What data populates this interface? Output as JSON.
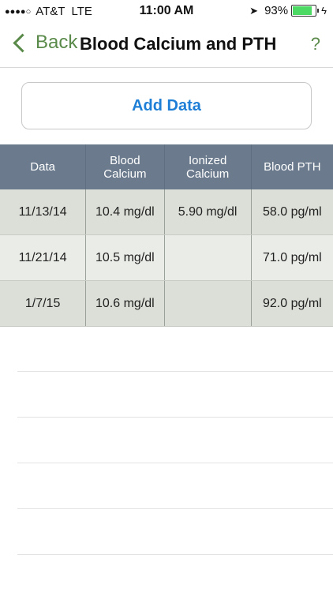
{
  "status_bar": {
    "signal": "●●●●○",
    "carrier": "AT&T",
    "network": "LTE",
    "time": "11:00 AM",
    "battery_pct": "93%",
    "battery_level": 0.93
  },
  "nav": {
    "back_label": "Back",
    "title": "Blood Calcium and PTH",
    "help_label": "?"
  },
  "add_button": {
    "label": "Add Data"
  },
  "table": {
    "headers": {
      "date": "Data",
      "blood_calcium": "Blood\nCalcium",
      "ionized_calcium": "Ionized\nCalcium",
      "blood_pth": "Blood PTH"
    },
    "rows": [
      {
        "date": "11/13/14",
        "blood_calcium": "10.4 mg/dl",
        "ionized_calcium": "5.90 mg/dl",
        "blood_pth": "58.0 pg/ml"
      },
      {
        "date": "11/21/14",
        "blood_calcium": "10.5 mg/dl",
        "ionized_calcium": "",
        "blood_pth": "71.0 pg/ml"
      },
      {
        "date": "1/7/15",
        "blood_calcium": "10.6 mg/dl",
        "ionized_calcium": "",
        "blood_pth": "92.0 pg/ml"
      }
    ]
  },
  "colors": {
    "accent_green": "#5a8a4a",
    "link_blue": "#1f7fd6",
    "header_slate": "#6b7b8d"
  }
}
